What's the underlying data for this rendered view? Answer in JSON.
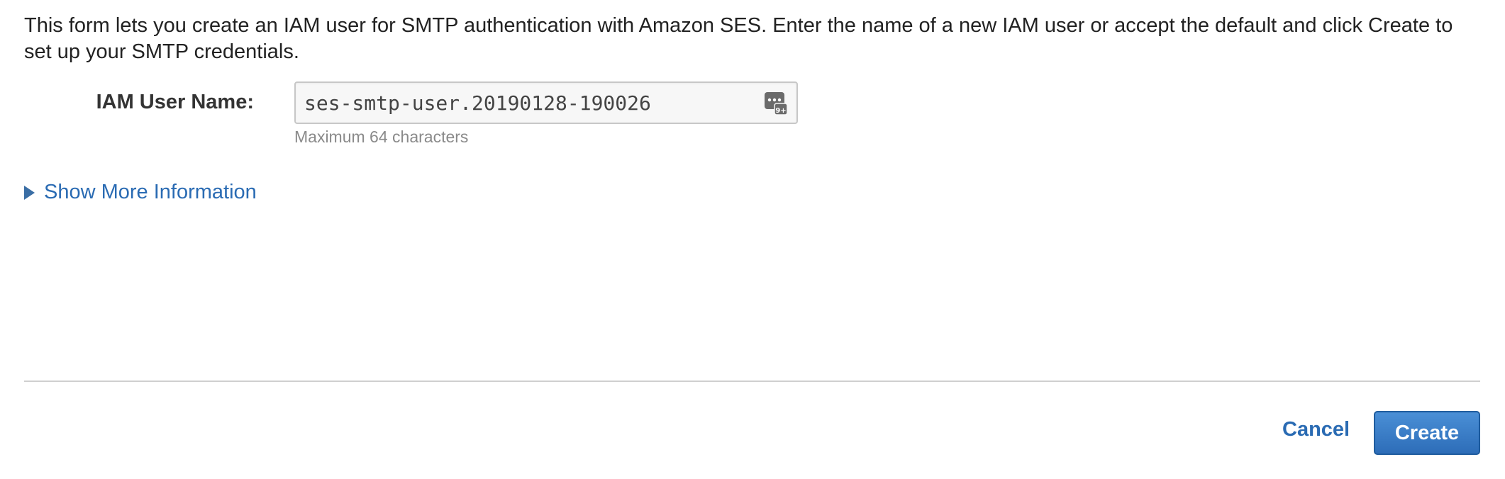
{
  "intro": {
    "text": "This form lets you create an IAM user for SMTP authentication with Amazon SES. Enter the name of a new IAM user or accept the default and click Create to set up your SMTP credentials."
  },
  "form": {
    "user_name_label": "IAM User Name:",
    "user_name_value": "ses-smtp-user.20190128-190026",
    "user_name_help": "Maximum 64 characters",
    "password_icon_badge": "9+"
  },
  "more_info": {
    "label": "Show More Information"
  },
  "actions": {
    "cancel_label": "Cancel",
    "create_label": "Create"
  },
  "colors": {
    "link": "#2a6bb3",
    "primary_button": "#2d6db8",
    "help_text": "#8a8a8a",
    "divider": "#cfcfcf"
  },
  "icons": {
    "expander": "triangle-right-icon",
    "input_accessory": "password-manager-icon"
  }
}
